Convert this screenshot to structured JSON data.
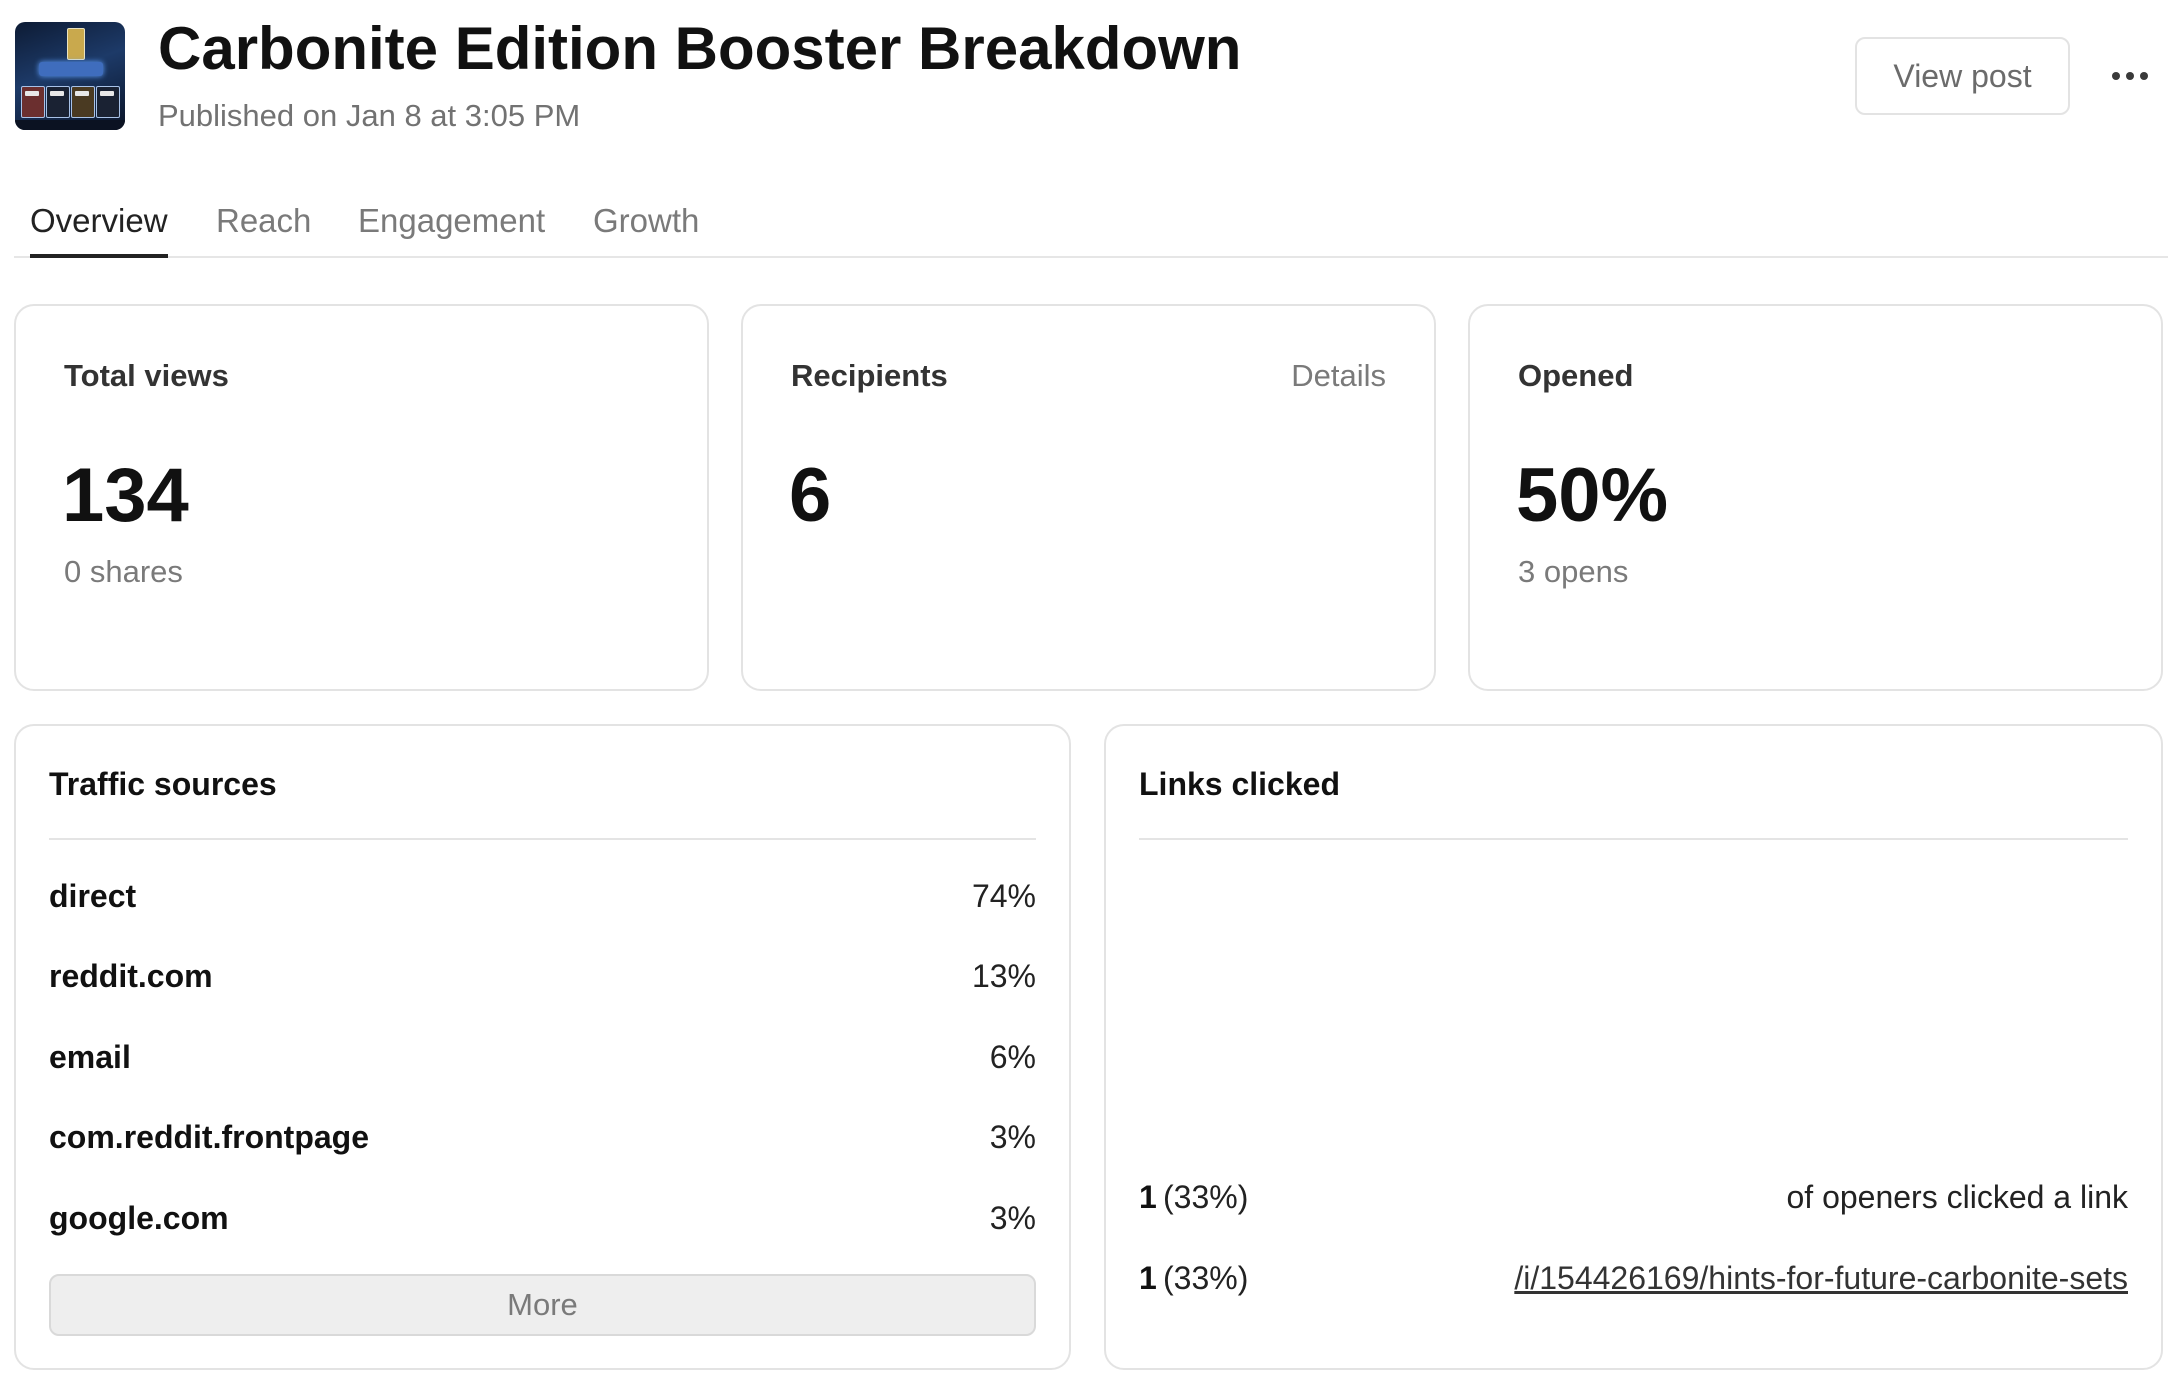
{
  "header": {
    "title": "Carbonite Edition Booster Breakdown",
    "published": "Published on Jan 8 at 3:05 PM",
    "view_post_label": "View post",
    "thumbnail_icon": "post-thumbnail-image",
    "more_icon": "more-horizontal-icon"
  },
  "tabs": [
    {
      "label": "Overview",
      "active": true
    },
    {
      "label": "Reach",
      "active": false
    },
    {
      "label": "Engagement",
      "active": false
    },
    {
      "label": "Growth",
      "active": false
    }
  ],
  "stats": {
    "total_views": {
      "label": "Total views",
      "value": "134",
      "sub": "0 shares"
    },
    "recipients": {
      "label": "Recipients",
      "value": "6",
      "link": "Details"
    },
    "opened": {
      "label": "Opened",
      "value": "50%",
      "sub": "3 opens"
    }
  },
  "traffic_sources": {
    "title": "Traffic sources",
    "rows": [
      {
        "name": "direct",
        "pct": "74%"
      },
      {
        "name": "reddit.com",
        "pct": "13%"
      },
      {
        "name": "email",
        "pct": "6%"
      },
      {
        "name": "com.reddit.frontpage",
        "pct": "3%"
      },
      {
        "name": "google.com",
        "pct": "3%"
      }
    ],
    "more_label": "More"
  },
  "links_clicked": {
    "title": "Links clicked",
    "rows": [
      {
        "count": "1",
        "pct": "(33%)",
        "text": "of openers clicked a link"
      },
      {
        "count": "1",
        "pct": "(33%)",
        "url": "/i/154426169/hints-for-future-carbonite-sets"
      }
    ]
  },
  "colors": {
    "text_primary": "#111111",
    "text_muted": "#7a7a7a",
    "border": "#e3e3e3",
    "button_bg": "#eeeeee"
  }
}
